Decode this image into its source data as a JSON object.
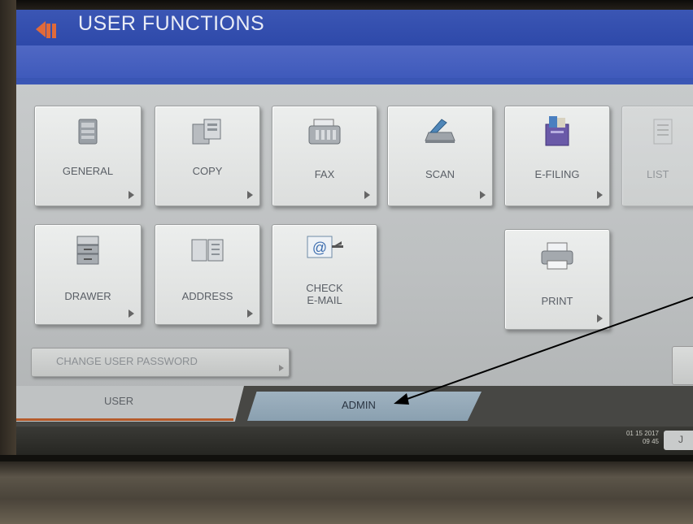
{
  "screen": {
    "title": "USER FUNCTIONS"
  },
  "tiles": [
    {
      "label": "GENERAL",
      "icon": "general-settings-icon"
    },
    {
      "label": "COPY",
      "icon": "copy-icon"
    },
    {
      "label": "FAX",
      "icon": "fax-icon"
    },
    {
      "label": "SCAN",
      "icon": "scanner-icon"
    },
    {
      "label": "E-FILING",
      "icon": "e-filing-icon"
    },
    {
      "label": "LIST",
      "icon": "list-icon"
    },
    {
      "label": "DRAWER",
      "icon": "drawer-icon"
    },
    {
      "label": "ADDRESS",
      "icon": "address-book-icon"
    },
    {
      "label": "CHECK",
      "label2": "E-MAIL",
      "icon": "check-email-icon"
    },
    {
      "label": "PRINT",
      "icon": "printer-icon"
    }
  ],
  "password_button": {
    "label": "CHANGE USER PASSWORD"
  },
  "tabs": {
    "user": "USER",
    "admin": "ADMIN"
  },
  "status": {
    "date": "01 15 2017",
    "time": "09 45",
    "stub_label": "J"
  },
  "colors": {
    "title_bar": "#2c47a8",
    "admin_tab": "#9fb2c0",
    "user_tab_underline": "#b55a2a",
    "annotation_arrow": "#000000"
  }
}
